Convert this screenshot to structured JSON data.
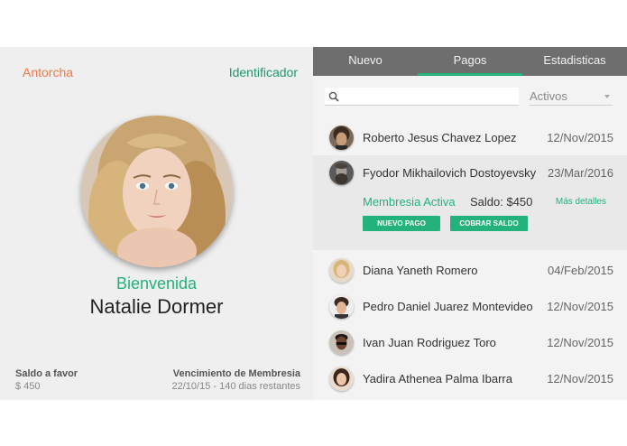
{
  "left_panel": {
    "top_left_link": "Antorcha",
    "top_right_link": "Identificador",
    "greeting": "Bienvenida",
    "user_name": "Natalie Dormer",
    "balance_label": "Saldo a favor",
    "balance_value": "$ 450",
    "membership_label": "Vencimiento de Membresia",
    "membership_value": "22/10/15 - 140 dias restantes"
  },
  "tabs": [
    {
      "label": "Nuevo"
    },
    {
      "label": "Pagos"
    },
    {
      "label": "Estadisticas"
    }
  ],
  "filter": {
    "search_placeholder": "",
    "status_selected": "Activos"
  },
  "contacts": [
    {
      "name": "Roberto Jesus Chavez Lopez",
      "date": "12/Nov/2015"
    },
    {
      "name": "Fyodor Mikhailovich Dostoyevsky",
      "date": "23/Mar/2016"
    },
    {
      "name": "Diana Yaneth Romero",
      "date": "04/Feb/2015"
    },
    {
      "name": "Pedro Daniel Juarez Montevideo",
      "date": "12/Nov/2015"
    },
    {
      "name": "Ivan Juan Rodriguez Toro",
      "date": "12/Nov/2015"
    },
    {
      "name": "Yadira Athenea Palma Ibarra",
      "date": "12/Nov/2015"
    }
  ],
  "expanded": {
    "status": "Membresia Activa",
    "balance": "Saldo: $450",
    "details_link": "Más detalles",
    "button_new_payment": "NUEVO PAGO",
    "button_collect": "COBRAR SALDO"
  },
  "colors": {
    "accent_green": "#23b27b",
    "accent_orange": "#f07a48",
    "tabbar": "#6e6e6e"
  }
}
